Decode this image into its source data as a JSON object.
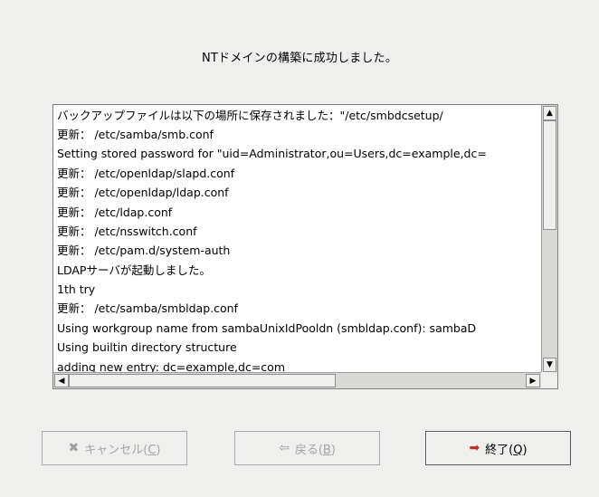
{
  "dialog": {
    "message": "NTドメインの構築に成功しました。"
  },
  "log": {
    "lines": [
      "バックアップファイルは以下の場所に保存されました：\"/etc/smbdcsetup/",
      "更新： /etc/samba/smb.conf",
      "Setting stored password for \"uid=Administrator,ou=Users,dc=example,dc=",
      "更新： /etc/openldap/slapd.conf",
      "更新： /etc/openldap/ldap.conf",
      "更新： /etc/ldap.conf",
      "更新： /etc/nsswitch.conf",
      "更新： /etc/pam.d/system-auth",
      "LDAPサーバが起動しました。",
      "1th try",
      "更新： /etc/samba/smbldap.conf",
      "Using workgroup name from sambaUnixIdPooldn (smbldap.conf): sambaD",
      "Using builtin directory structure",
      "adding new entry: dc=example,dc=com"
    ],
    "scroll_up_glyph": "▲",
    "scroll_down_glyph": "▼",
    "scroll_left_glyph": "◀",
    "scroll_right_glyph": "▶"
  },
  "buttons": {
    "cancel": {
      "icon": "✖",
      "label": "キャンセル(",
      "mnemonic": "C",
      "suffix": ")",
      "enabled": false
    },
    "back": {
      "icon": "⇦",
      "label": "戻る(",
      "mnemonic": "B",
      "suffix": ")",
      "enabled": false
    },
    "finish": {
      "icon": "➡",
      "label": "終了(",
      "mnemonic": "Q",
      "suffix": ")",
      "enabled": true
    }
  },
  "colors": {
    "background": "#efefee",
    "finish_icon": "#c0302a"
  }
}
